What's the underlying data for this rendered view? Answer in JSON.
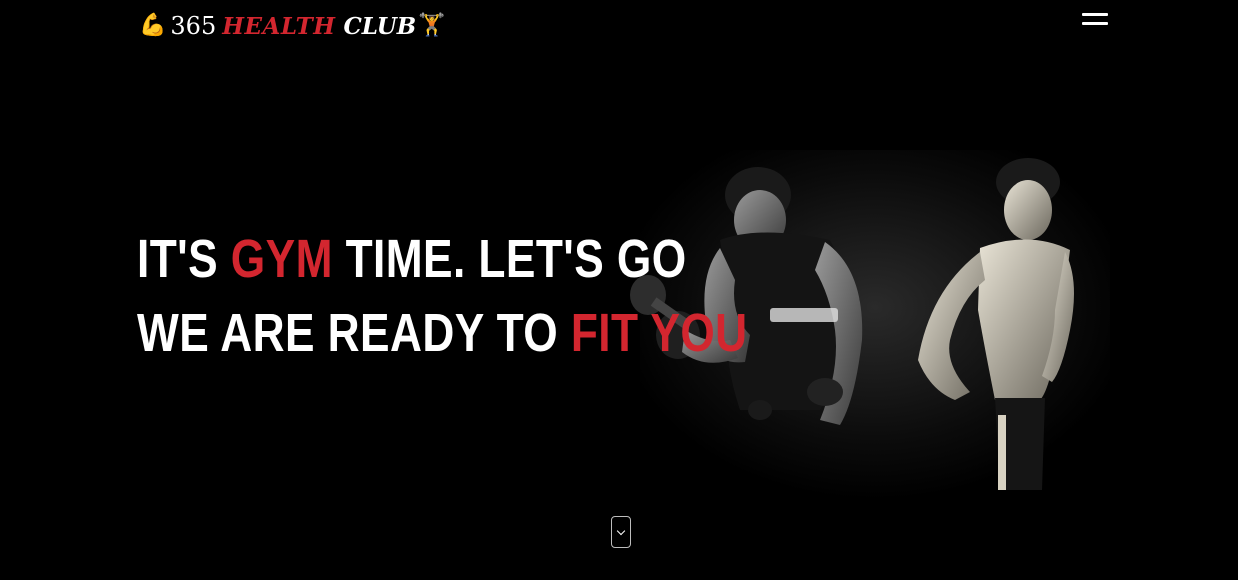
{
  "header": {
    "logo_emoji_left": "💪",
    "logo_number": "365",
    "logo_word_health": "HEALTH",
    "logo_word_club": "CLUB",
    "logo_emoji_right": "🏋️",
    "menu_icon": "hamburger-menu-icon"
  },
  "hero": {
    "line1": {
      "part1": "IT'S ",
      "highlight": "GYM",
      "part2": " TIME. LET'S GO"
    },
    "line2": {
      "part1": "WE ARE READY TO ",
      "highlight": "FIT YOU"
    },
    "image": "two-bodybuilders-photo",
    "scroll_icon": "chevron-down-icon"
  },
  "colors": {
    "background": "#000000",
    "accent": "#d3262f",
    "text": "#ffffff"
  }
}
